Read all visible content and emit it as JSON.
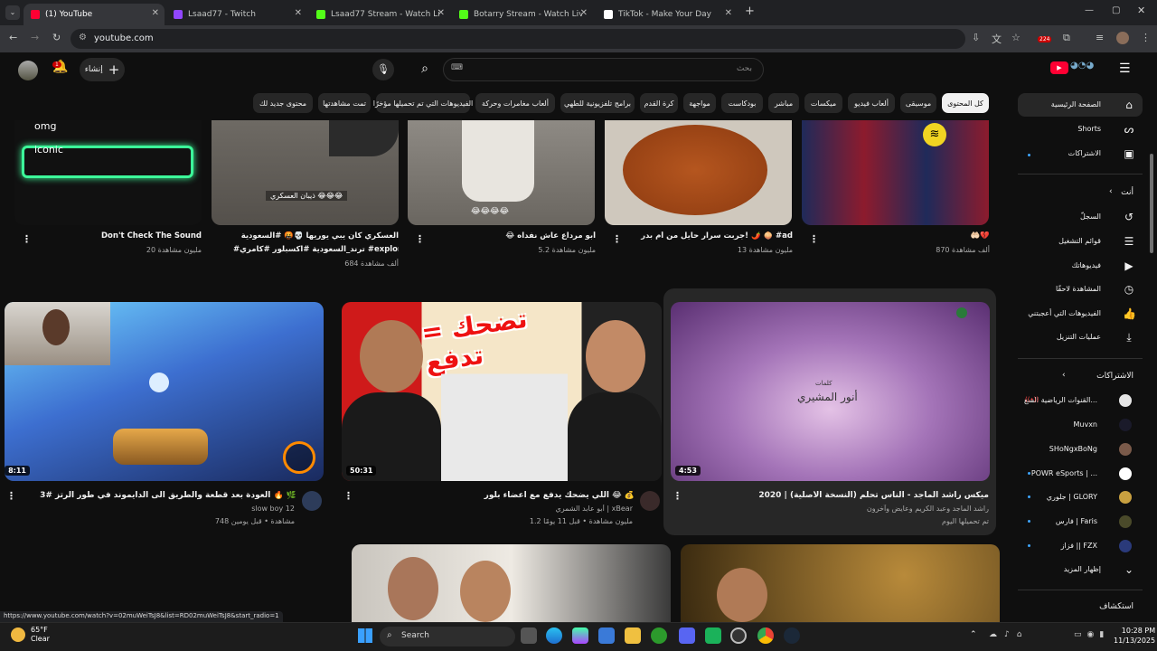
{
  "browser": {
    "tabs": [
      {
        "label": "(1) YouTube",
        "active": true,
        "color": "#ff0033"
      },
      {
        "label": "Lsaad77 - Twitch",
        "active": false,
        "color": "#9146ff"
      },
      {
        "label": "Lsaad77 Stream - Watch Live o",
        "active": false,
        "color": "#53fc18"
      },
      {
        "label": "Botarry Stream - Watch Live on",
        "active": false,
        "color": "#53fc18"
      },
      {
        "label": "TikTok - Make Your Day",
        "active": false,
        "color": "#ffffff"
      }
    ],
    "new_tab": "+",
    "url": "youtube.com",
    "extension_badge": "224",
    "status_url": "https://www.youtube.com/watch?v=02muWeiTsJ8&list=RD02muWeiTsJ8&start_radio=1"
  },
  "masthead": {
    "search_placeholder": "بحث",
    "create_label": "إنشاء",
    "notification_count": "1"
  },
  "chips": [
    {
      "label": "كل المحتوى",
      "active": true
    },
    {
      "label": "موسيقى"
    },
    {
      "label": "ألعاب فيديو"
    },
    {
      "label": "ميكسات"
    },
    {
      "label": "مباشر"
    },
    {
      "label": "بودكاست"
    },
    {
      "label": "مواجهة"
    },
    {
      "label": "كرة القدم"
    },
    {
      "label": "برامج تلفزيونية للطهي"
    },
    {
      "label": "ألعاب مغامرات وحركة"
    },
    {
      "label": "الفيديوهات التي تم تحميلها مؤخرًا"
    },
    {
      "label": "تمت مشاهدتها"
    },
    {
      "label": "محتوى جديد لك"
    }
  ],
  "sidebar": {
    "home": "الصفحة الرئيسية",
    "shorts": "Shorts",
    "subscriptions": "الاشتراكات",
    "you": "أنت",
    "history": "السجلّ",
    "playlists": "قوائم التشغيل",
    "your_videos": "فيديوهاتك",
    "watch_later": "المشاهدة لاحقًا",
    "liked": "الفيديوهات التي أعجبتني",
    "downloads": "عمليات التنزيل",
    "subs_header": "الاشتراكات",
    "channels": [
      {
        "name": "القنوات الرياضية السع...",
        "live": true
      },
      {
        "name": "Muvxn"
      },
      {
        "name": "SHoNgxBoNg"
      },
      {
        "name": "POWR eSports | ..."
      },
      {
        "name": "جلوري | GLORY"
      },
      {
        "name": "فارس | Faris"
      },
      {
        "name": "فزاز || FZX"
      }
    ],
    "show_more": "إظهار المزيد",
    "explore": "استكشاف"
  },
  "shorts": [
    {
      "title": "Don't Check The Sound",
      "views": "20 مليون مشاهدة",
      "overlay": [
        "omg",
        "iconic"
      ]
    },
    {
      "title": "العسكري كان يبي يوريها 💀🤬 #السعودية",
      "title2": "#ترند_السعودية #اكسبلور #كامري #explore ...",
      "views": "684 ألف مشاهدة",
      "overlay": [
        "ذيبان العسكري 😂😂😂"
      ]
    },
    {
      "title": "😂 أبو مرداع عاش نفداه",
      "views": "5.2 مليون مشاهدة",
      "overlay": [
        "😂😂😂😂"
      ]
    },
    {
      "title": "جربت سرار حايل من أم بدر! 🌶️ 🧅 #ad",
      "views": "13 مليون مشاهدة"
    },
    {
      "title": "🤲🏻💔",
      "views": "870 ألف مشاهدة"
    }
  ],
  "videos": [
    {
      "title": "العودة بعد قطعة والطريق الى الدايموند في طور الرتز #3 🔥 🌿",
      "channel": "slow boy 12",
      "meta": "748 مشاهدة • قبل يومين",
      "duration": "8:11"
    },
    {
      "title": "اللي يضحك يدفع مع اعضاء بلور 😂 💰",
      "channel": "أبو عابد الشمري | xBear",
      "meta": "1.2 مليون مشاهدة • قبل 11 يومًا",
      "duration": "50:31",
      "thumb_text": "تضحك = تدفع"
    },
    {
      "title": "ميكس راشد الماجد - الناس تحلم (النسخة الأصلية) | 2020",
      "channel": "راشد الماجد وعبد الكريم وعايض وآخرون",
      "meta": "تم تحميلها اليوم",
      "duration": "4:53",
      "thumb_text": "أنور المشيري",
      "thumb_small": "كلمات"
    }
  ],
  "taskbar": {
    "temp": "65°F",
    "weather": "Clear",
    "search": "Search",
    "time": "10:28 PM",
    "date": "11/13/2025"
  }
}
